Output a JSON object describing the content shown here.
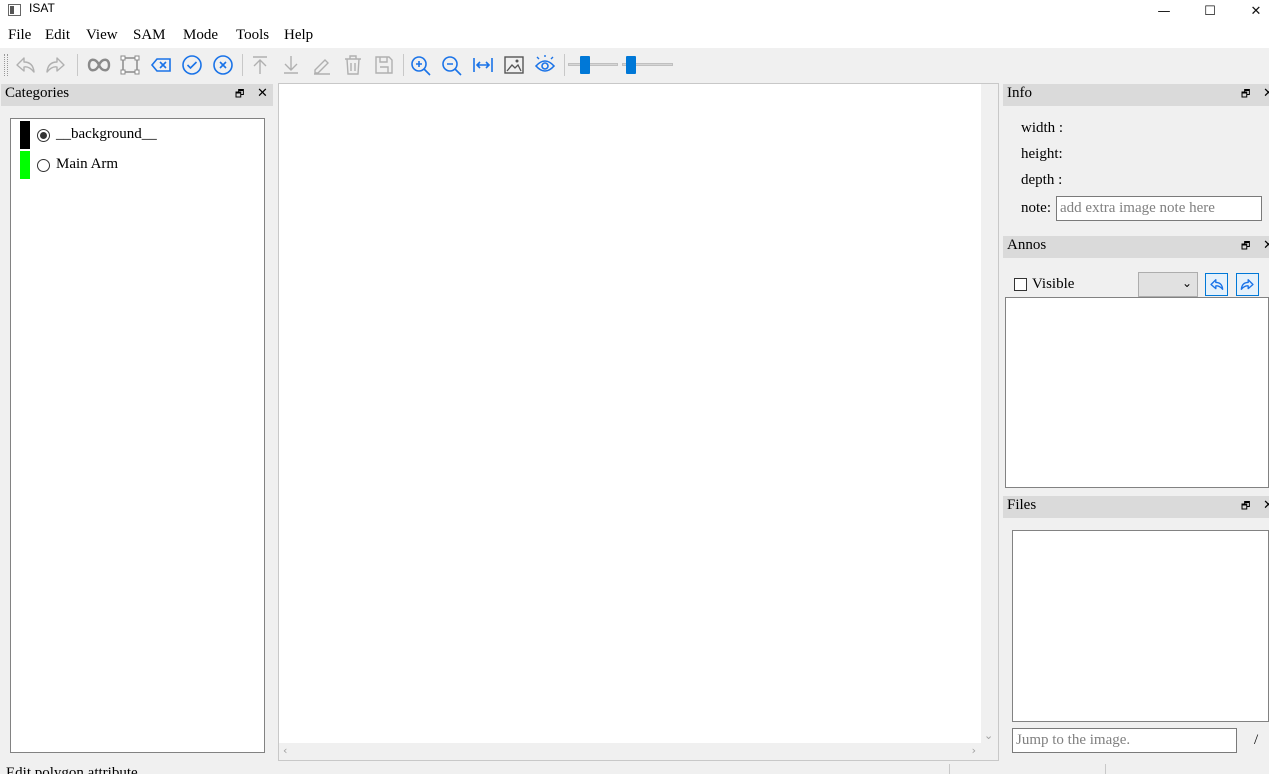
{
  "window": {
    "title": "ISAT",
    "minimize": "—",
    "maximize": "☐",
    "close": "✕"
  },
  "menu": [
    "File",
    "Edit",
    "View",
    "SAM",
    "Mode",
    "Tools",
    "Help"
  ],
  "toolbar": {
    "icons": [
      "undo-icon",
      "redo-icon",
      "sam-segment-icon",
      "polygon-icon",
      "backspace-icon",
      "finish-icon",
      "cancel-icon",
      "move-top-icon",
      "move-bottom-icon",
      "edit-icon",
      "delete-icon",
      "save-icon",
      "zoom-in-icon",
      "zoom-out-icon",
      "fit-window-icon",
      "background-image-icon",
      "visible-icon"
    ],
    "sliders": [
      {
        "name": "opacity-slider",
        "level": 0.3
      },
      {
        "name": "point-size-slider",
        "level": 0.1
      }
    ]
  },
  "categories": {
    "title": "Categories",
    "items": [
      {
        "label": "__background__",
        "color": "#000000",
        "selected": true
      },
      {
        "label": "Main Arm",
        "color": "#00ff00",
        "selected": false
      }
    ]
  },
  "info": {
    "title": "Info",
    "width_label": "width :",
    "height_label": "height:",
    "depth_label": "depth :",
    "note_label": "note:",
    "note_placeholder": "add extra image note here"
  },
  "annos": {
    "title": "Annos",
    "visible_label": "Visible",
    "visible_checked": false
  },
  "files": {
    "title": "Files",
    "jump_placeholder": "Jump to the image.",
    "page_sep": "/"
  },
  "status": {
    "text": "Edit polygon attribute"
  },
  "dock": {
    "float": "🗗",
    "close": "✕"
  },
  "colors": {
    "accent": "#0078d7",
    "title_bar": "#dadada"
  }
}
